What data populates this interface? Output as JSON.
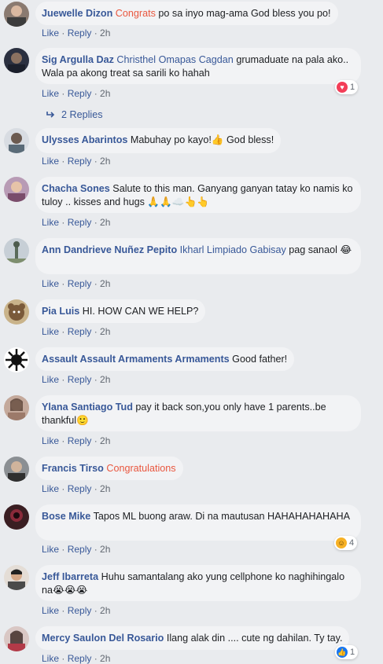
{
  "comments": [
    {
      "author": "Juewelle Dizon",
      "tag": "Congrats",
      "tag_color": "#e9573f",
      "text": "po sa inyo mag-ama God bless you po!",
      "like": "Like",
      "reply": "Reply",
      "time": "2h"
    },
    {
      "author": "Sig Argulla Daz",
      "tag": "Christhel Omapas Cagdan",
      "tag_color": "#385898",
      "text": "grumaduate na pala ako.. Wala pa akong treat sa sarili ko hahah",
      "like": "Like",
      "reply": "Reply",
      "time": "2h",
      "reaction": {
        "icon": "heart-icon",
        "count": "1",
        "color": "#f33e58"
      }
    },
    {
      "author": "Ulysses Abarintos",
      "text": "Mabuhay po kayo!👍 God bless!",
      "like": "Like",
      "reply": "Reply",
      "time": "2h"
    },
    {
      "author": "Chacha Sones",
      "text": "Salute to this man. Ganyang ganyan tatay ko namis ko tuloy .. kisses and hugs 🙏🙏☁️👆👆",
      "like": "Like",
      "reply": "Reply",
      "time": "2h"
    },
    {
      "author": "Ann Dandrieve Nuñez Pepito",
      "tag": "Ikharl Limpiado Gabisay",
      "tag_color": "#385898",
      "text": "pag sanaol 😂",
      "like": "Like",
      "reply": "Reply",
      "time": "2h"
    },
    {
      "author": "Pia Luis",
      "text": "HI. HOW CAN WE HELP?",
      "like": "Like",
      "reply": "Reply",
      "time": "2h"
    },
    {
      "author": "Assault Assault Armaments Armaments",
      "text": "Good father!",
      "like": "Like",
      "reply": "Reply",
      "time": "2h"
    },
    {
      "author": "Ylana Santiago Tud",
      "text": "pay it back son,you only have 1 parents..be thankful🙂",
      "like": "Like",
      "reply": "Reply",
      "time": "2h"
    },
    {
      "author": "Francis Tirso",
      "tag": "Congratulations",
      "tag_color": "#e9573f",
      "text": "",
      "like": "Like",
      "reply": "Reply",
      "time": "2h"
    },
    {
      "author": "Bose Mike",
      "text": "Tapos ML buong araw. Di na mautusan HAHAHAHAHAHA",
      "like": "Like",
      "reply": "Reply",
      "time": "2h",
      "reaction": {
        "icon": "laugh-icon",
        "count": "4",
        "color": "#f7b125"
      }
    },
    {
      "author": "Jeff Ibarreta",
      "text": "Huhu samantalang ako yung cellphone ko naghihingalo na😭😭😭",
      "like": "Like",
      "reply": "Reply",
      "time": "2h"
    },
    {
      "author": "Mercy Saulon Del Rosario",
      "text": "Ilang alak din .... cute ng dahilan. Ty tay.",
      "like": "Like",
      "reply": "Reply",
      "time": "2h",
      "reaction": {
        "icon": "thumbs-up-icon",
        "count": "1",
        "color": "#1877f2"
      }
    }
  ],
  "replies_link": {
    "icon": "reply-arrow-icon",
    "label": "2 Replies"
  }
}
